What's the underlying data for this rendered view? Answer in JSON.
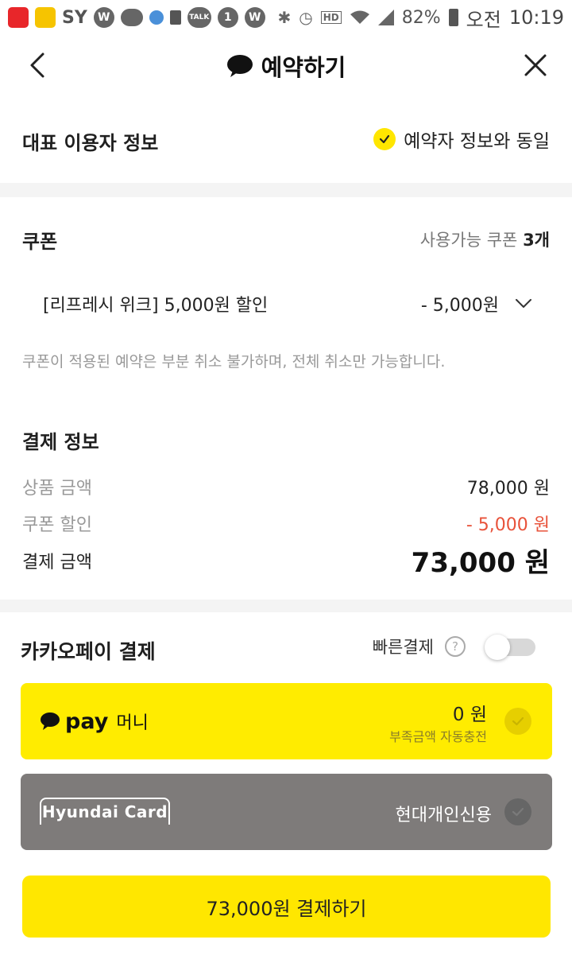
{
  "status_bar": {
    "left_texts": [
      "SY"
    ],
    "battery": "82%",
    "ampm": "오전",
    "time": "10:19",
    "icons": [
      "app-shopping-icon",
      "app-kb-icon",
      "w-icon",
      "chat-bubble-icon",
      "dot-icon",
      "sim-icon",
      "talk-icon",
      "badge-1-icon",
      "w-icon",
      "bluetooth-icon",
      "alarm-icon",
      "hd-voice-icon",
      "wifi-icon",
      "signal-icon",
      "battery-icon"
    ],
    "badge_one": "1",
    "talk_label": "TALK",
    "hd_label": "HD"
  },
  "header": {
    "title": "예약하기"
  },
  "user_section": {
    "label": "대표 이용자 정보",
    "same_label": "예약자 정보와 동일"
  },
  "coupon": {
    "title": "쿠폰",
    "available_prefix": "사용가능 쿠폰 ",
    "available_count": "3개",
    "selected_name": "[리프레시 위크] 5,000원 할인",
    "selected_amount": "- 5,000원",
    "notice": "쿠폰이 적용된 예약은 부분 취소 불가하며, 전체 취소만 가능합니다."
  },
  "payment_info": {
    "title": "결제 정보",
    "product_label": "상품 금액",
    "product_value": "78,000 원",
    "discount_label": "쿠폰 할인",
    "discount_value": "- 5,000 원",
    "total_label": "결제 금액",
    "total_value": "73,000 원"
  },
  "kakaopay": {
    "title": "카카오페이 결제",
    "quick_label": "빠른결제",
    "help_symbol": "?",
    "quick_enabled": false,
    "pay_word": "pay",
    "money_label": "머니",
    "money_amount": "0 원",
    "money_sub": "부족금액 자동충전",
    "card_logo": "Hyundai Card",
    "card_name": "현대개인신용",
    "pay_button": "73,000원 결제하기"
  },
  "colors": {
    "accent_yellow": "#ffe700",
    "discount_red": "#e8523a",
    "card_gray": "#7e7b7a"
  }
}
